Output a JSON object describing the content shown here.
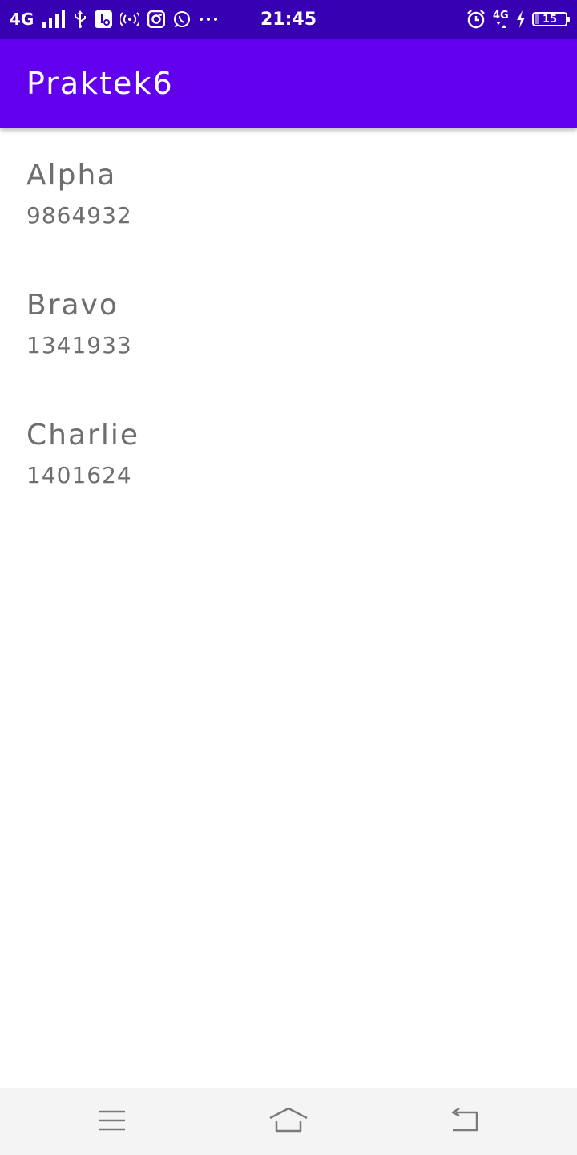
{
  "status_bar": {
    "network": "4G",
    "time": "21:45",
    "network_right": "4G",
    "battery_level": 15,
    "battery_text": "15",
    "icons_left": [
      "signal-icon",
      "usb-icon",
      "usb-debug-icon",
      "hotspot-icon",
      "instagram-icon",
      "whatsapp-icon",
      "more-icon"
    ],
    "icons_right": [
      "alarm-icon",
      "data-icon",
      "charging-icon",
      "battery-icon"
    ]
  },
  "app_bar": {
    "title": "Praktek6",
    "color": "#6200ee"
  },
  "contacts": [
    {
      "name": "Alpha",
      "phone": "9864932"
    },
    {
      "name": "Bravo",
      "phone": "1341933"
    },
    {
      "name": "Charlie",
      "phone": "1401624"
    }
  ],
  "nav_bar": {
    "buttons": [
      "menu-icon",
      "home-icon",
      "back-icon"
    ]
  },
  "colors": {
    "status_bar": "#3700b3",
    "app_bar": "#6200ee",
    "text": "#6e6e6e"
  }
}
